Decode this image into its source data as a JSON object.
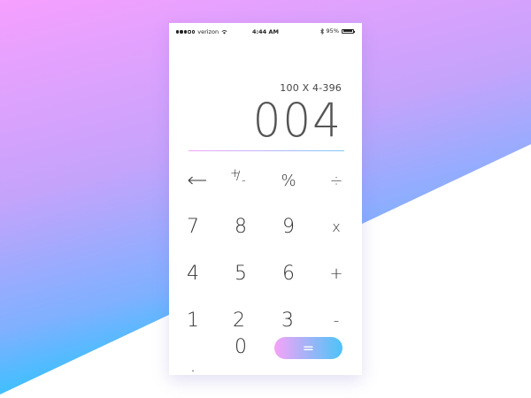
{
  "colors": {
    "bg_top_left": "#f6a3ff",
    "bg_bottom_left": "#12c9ff",
    "bg_mid": "#a09cf5",
    "accent_pink": "#f5a3f7",
    "accent_blue": "#4cc4f7",
    "text": "#333333"
  },
  "status_bar": {
    "carrier": "verizon",
    "wifi_icon": "wifi-icon",
    "time": "4:44 AM",
    "bluetooth_icon": "bluetooth-icon",
    "battery_percent": "95%",
    "battery_level": 0.95
  },
  "display": {
    "expression": "100 X 4-396",
    "result": "004"
  },
  "keypad": {
    "backspace": "←",
    "sign": "+/-",
    "sign_plus": "+",
    "sign_minus": "-",
    "percent": "%",
    "divide": "÷",
    "seven": "7",
    "eight": "8",
    "nine": "9",
    "multiply": "x",
    "four": "4",
    "five": "5",
    "six": "6",
    "plus": "+",
    "one": "1",
    "two": "2",
    "three": "3",
    "minus": "-",
    "decimal": ".",
    "zero": "0",
    "equals": "="
  }
}
